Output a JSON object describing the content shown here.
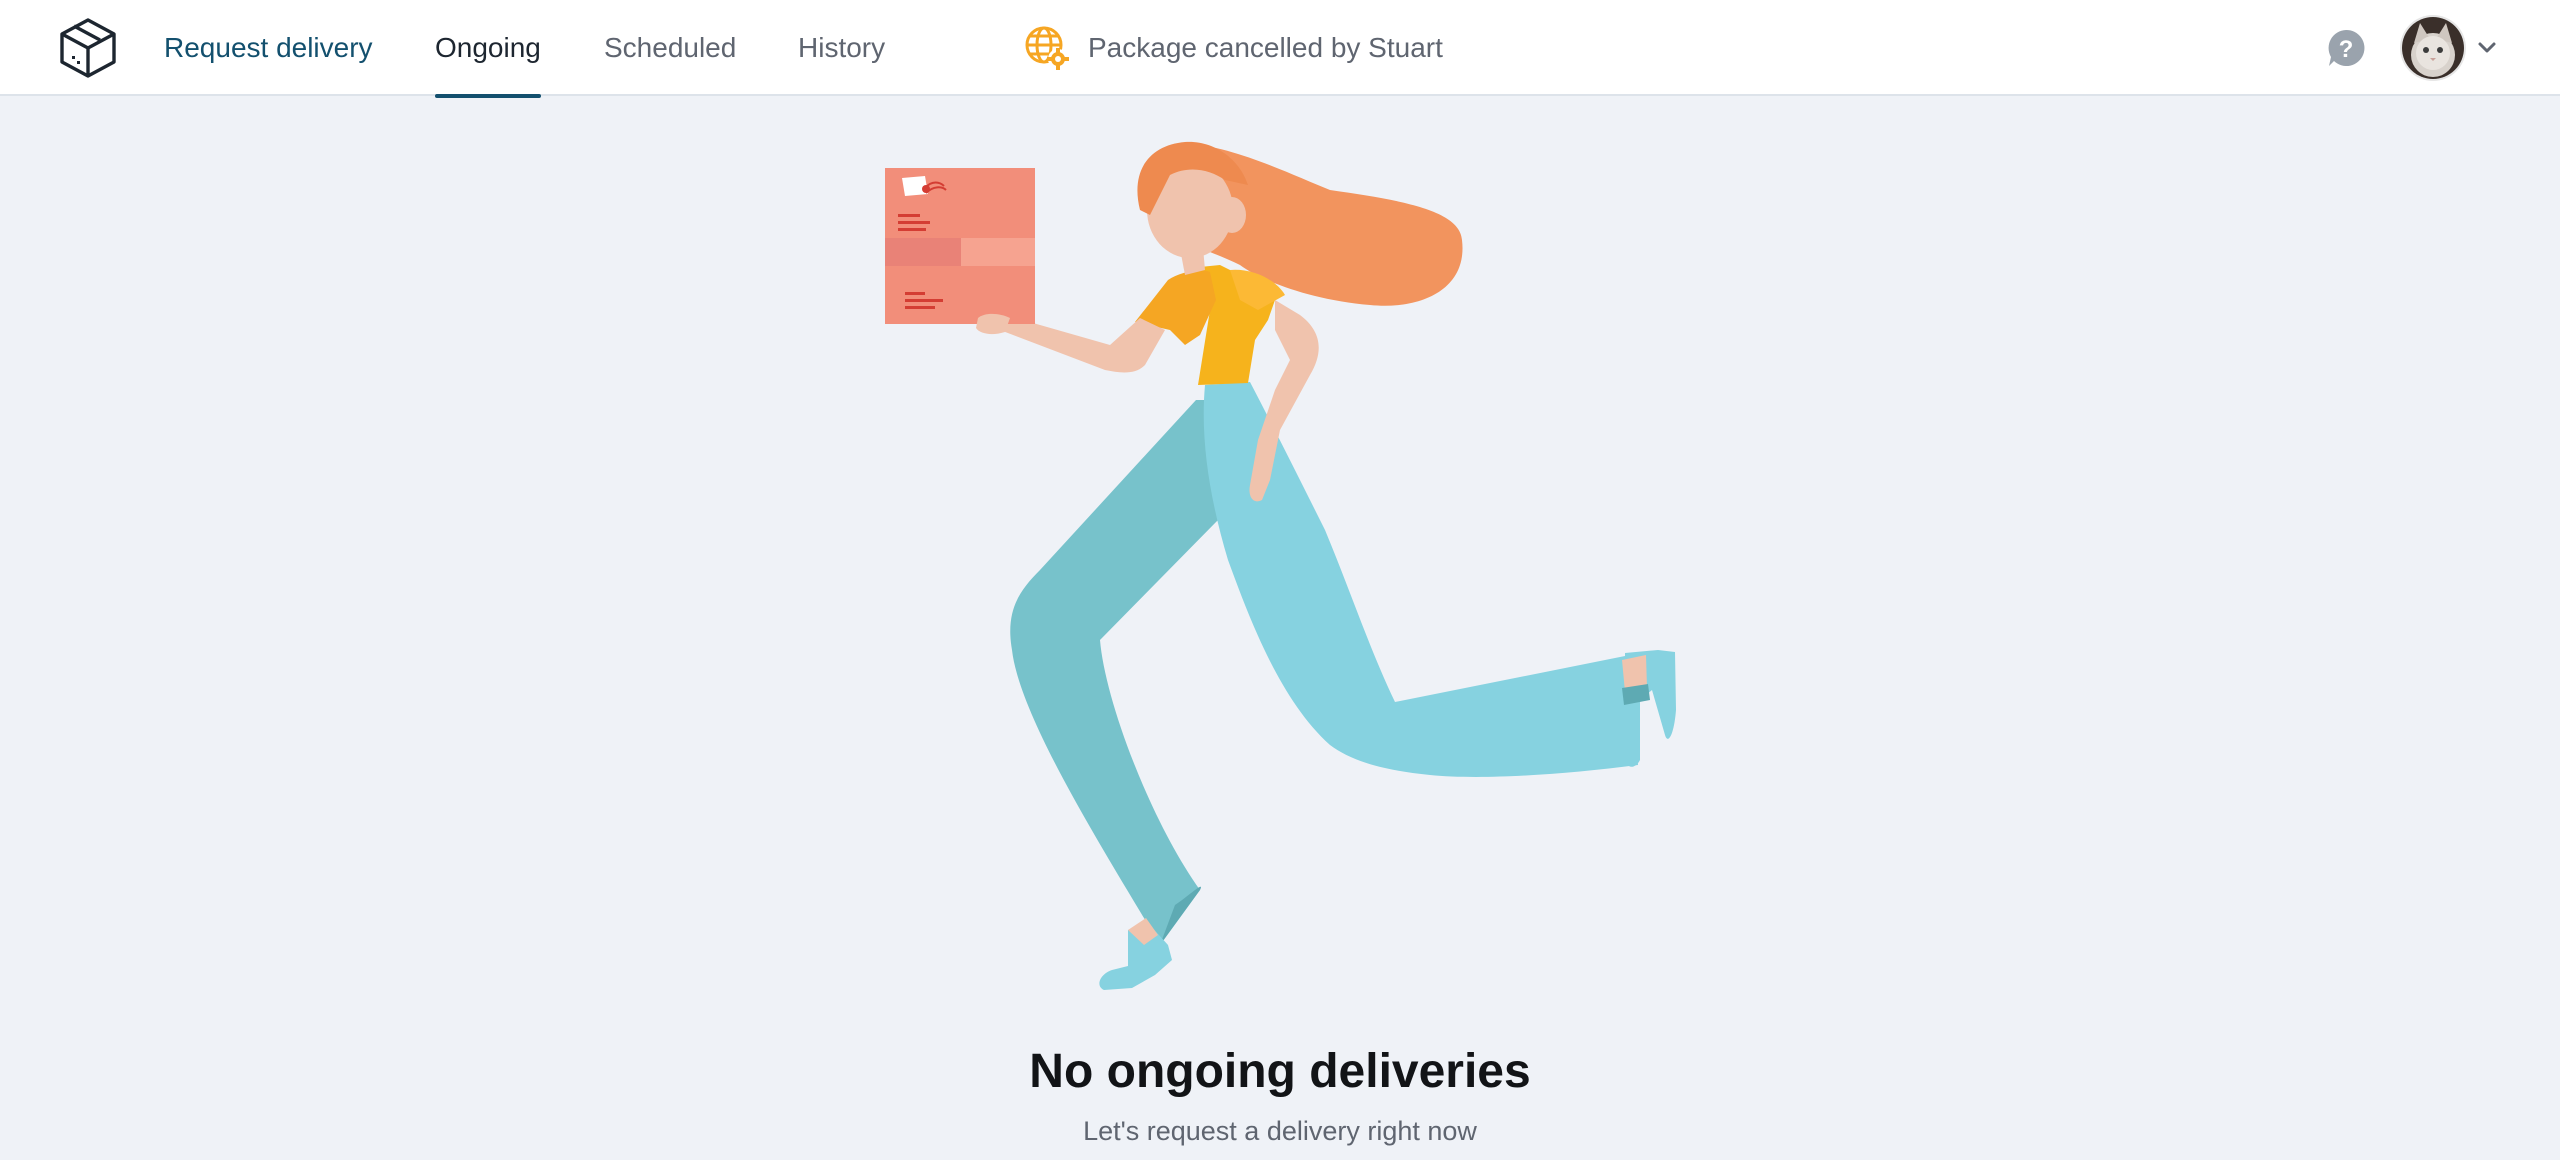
{
  "nav": {
    "request_delivery": "Request delivery",
    "tabs": [
      {
        "label": "Ongoing",
        "active": true
      },
      {
        "label": "Scheduled",
        "active": false
      },
      {
        "label": "History",
        "active": false
      }
    ]
  },
  "notification": {
    "icon": "globe-gear-icon",
    "text": "Package cancelled by Stuart"
  },
  "header_icons": {
    "help": "help-icon",
    "avatar": "user-avatar",
    "menu": "chevron-down-icon"
  },
  "empty_state": {
    "illustration": "woman-running-with-package",
    "title": "No ongoing deliveries",
    "subtitle": "Let's request a delivery right now"
  },
  "colors": {
    "brand": "#13506e",
    "accent_orange": "#f6a623",
    "background": "#eff2f7",
    "topbar": "#ffffff"
  }
}
